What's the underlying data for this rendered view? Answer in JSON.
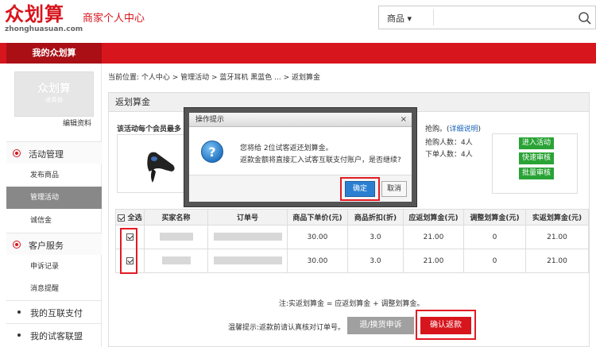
{
  "header": {
    "logo_text": "众划算",
    "logo_domain": "zhonghuasuan.com",
    "site_title": "商家个人中心",
    "search_category": "商品",
    "search_icon": "search-icon"
  },
  "nav": {
    "home_label": "我的众划算"
  },
  "sidebar": {
    "avatar_logo": "众划算",
    "avatar_sub": "-承真相-",
    "edit_label": "编辑资料",
    "sections": [
      {
        "label": "活动管理",
        "items": [
          "发布商品",
          "管理活动",
          "诚信金"
        ],
        "active": "管理活动"
      },
      {
        "label": "客户服务",
        "items": [
          "申诉记录",
          "消息提醒"
        ]
      }
    ],
    "links": [
      "我的互联支付",
      "我的试客联盟"
    ]
  },
  "breadcrumb": "当前位置: 个人中心 > 管理活动 > 蓝牙耳机 黑蓝色 ... > 返划算金",
  "panel": {
    "title": "返划算金",
    "activity_note": "该活动每个会员最多",
    "right_note": "抢购。",
    "right_note_link": "详细说明",
    "stats": [
      "抢购人数：4人",
      "下单人数：4人"
    ],
    "buttons": [
      "进入活动",
      "快速审核",
      "批量审核"
    ]
  },
  "table": {
    "headers": [
      "全选",
      "买家名称",
      "订单号",
      "商品下单价(元)",
      "商品折扣(折)",
      "应返划算金(元)",
      "调整划算金(元)",
      "实返划算金(元)"
    ],
    "rows": [
      {
        "price": "30.00",
        "discount": "3.0",
        "due": "21.00",
        "adjust": "0",
        "actual": "21.00"
      },
      {
        "price": "30.00",
        "discount": "3.0",
        "due": "21.00",
        "adjust": "0",
        "actual": "21.00"
      }
    ]
  },
  "formula": "注:实返划算金 = 应返划算金 + 调整划算金。",
  "tip": "温馨提示:返款前请认真核对订单号。",
  "actions": {
    "refund": "退/换货申诉",
    "confirm": "确认返款"
  },
  "dialog": {
    "title": "操作提示",
    "close": "×",
    "message_line1": "您将给 2位试客返还划算金。",
    "message_line2": "返款金额将直接汇入试客互联支付账户，是否继续?",
    "ok": "确定",
    "cancel": "取消"
  },
  "colors": {
    "brand_red": "#d7151d",
    "green": "#2aa336",
    "highlight": "#e31b23"
  }
}
